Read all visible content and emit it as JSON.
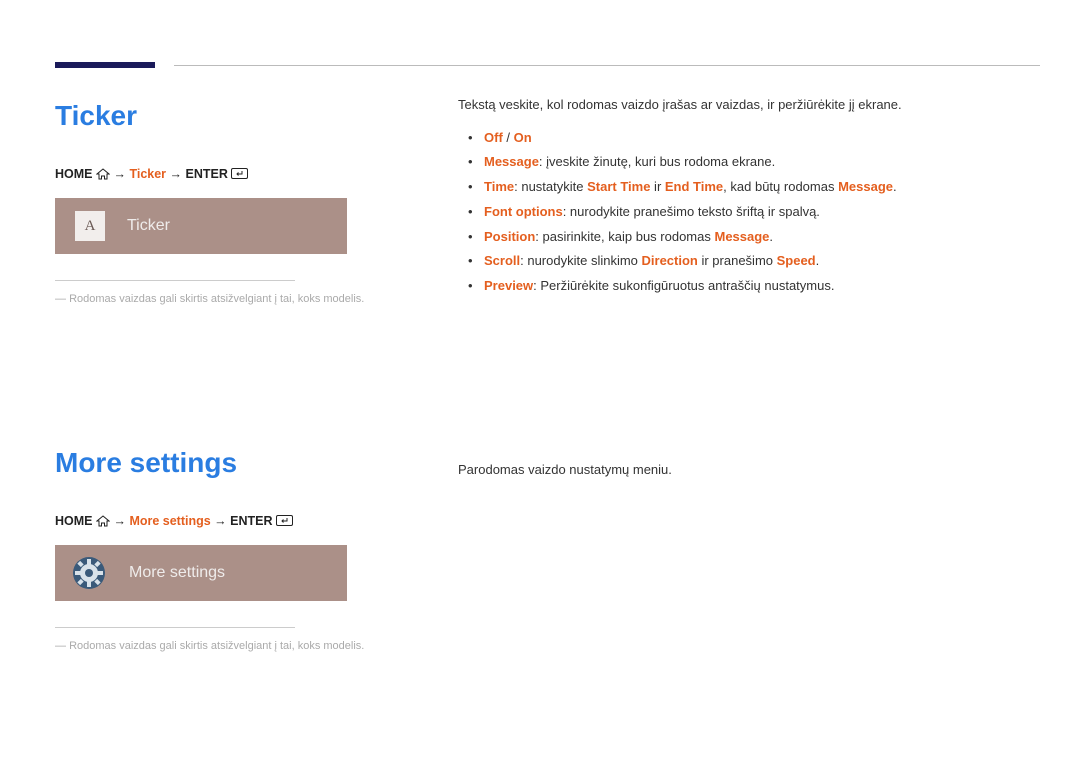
{
  "ticker": {
    "heading": "Ticker",
    "nav": {
      "home": "HOME",
      "path": "Ticker",
      "enter": "ENTER"
    },
    "menu_label": "Ticker",
    "menu_tile": "A",
    "disclaimer": "Rodomas vaizdas gali skirtis atsižvelgiant į tai, koks modelis.",
    "intro": "Tekstą veskite, kol rodomas vaizdo įrašas ar vaizdas, ir peržiūrėkite jį ekrane.",
    "b1": {
      "off": "Off",
      "sep": " / ",
      "on": "On"
    },
    "b2": {
      "key": "Message",
      "rest": ": įveskite žinutę, kuri bus rodoma ekrane."
    },
    "b3": {
      "key": "Time",
      "t1": ": nustatykite ",
      "start": "Start Time",
      "and": " ir ",
      "end": "End Time",
      "t2": ", kad būtų rodomas ",
      "msg": "Message",
      "dot": "."
    },
    "b4": {
      "key": "Font options",
      "rest": ": nurodykite pranešimo teksto šriftą ir spalvą."
    },
    "b5": {
      "key": "Position",
      "t1": ": pasirinkite, kaip bus rodomas ",
      "msg": "Message",
      "dot": "."
    },
    "b6": {
      "key": "Scroll",
      "t1": ": nurodykite slinkimo ",
      "dir": "Direction",
      "and": " ir pranešimo ",
      "spd": "Speed",
      "dot": "."
    },
    "b7": {
      "key": "Preview",
      "rest": ": Peržiūrėkite sukonfigūruotus antraščių nustatymus."
    }
  },
  "more": {
    "heading": "More settings",
    "nav": {
      "home": "HOME",
      "path": "More settings",
      "enter": "ENTER"
    },
    "menu_label": "More settings",
    "disclaimer": "Rodomas vaizdas gali skirtis atsižvelgiant į tai, koks modelis.",
    "body": "Parodomas vaizdo nustatymų meniu."
  }
}
